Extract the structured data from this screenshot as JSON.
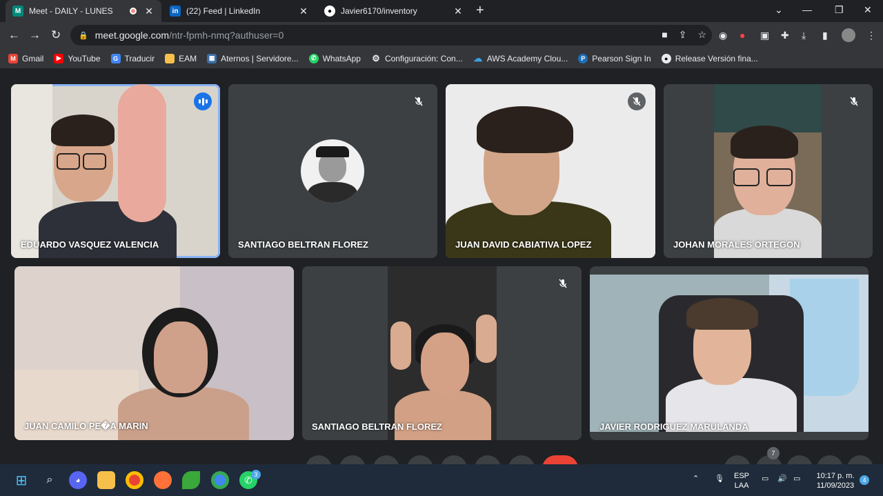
{
  "browser": {
    "tabs": [
      {
        "title": "Meet - DAILY - LUNES",
        "icon": "meet-icon"
      },
      {
        "title": "(22) Feed | LinkedIn",
        "icon": "linkedin-icon"
      },
      {
        "title": "Javier6170/inventory",
        "icon": "github-icon"
      }
    ],
    "url_host": "meet.google.com",
    "url_path": "/ntr-fpmh-nmq?authuser=0",
    "bookmarks": [
      {
        "label": "Gmail",
        "color": "#ea4335"
      },
      {
        "label": "YouTube",
        "color": "#ff0000"
      },
      {
        "label": "Traducir",
        "color": "#4285f4"
      },
      {
        "label": "EAM",
        "color": "#f6c04a"
      },
      {
        "label": "Aternos | Servidore...",
        "color": "#3b6ea5"
      },
      {
        "label": "WhatsApp",
        "color": "#25d366"
      },
      {
        "label": "Configuración: Con...",
        "color": "#9aa0a6"
      },
      {
        "label": "AWS Academy Clou...",
        "color": "#3aa0e6"
      },
      {
        "label": "Pearson Sign In",
        "color": "#1d6fb8"
      },
      {
        "label": "Release Versión fina...",
        "color": "#e8eaed"
      }
    ]
  },
  "meeting": {
    "participants": [
      {
        "name": "EDUARDO VASQUEZ VALENCIA",
        "speaking": true,
        "muted": false
      },
      {
        "name": "SANTIAGO BELTRAN FLOREZ",
        "speaking": false,
        "muted": true
      },
      {
        "name": "JUAN DAVID CABIATIVA LOPEZ",
        "speaking": false,
        "muted": true
      },
      {
        "name": "JOHAN MORALES ORTEGON",
        "speaking": false,
        "muted": true
      },
      {
        "name": "JUAN CAMILO PE�A MARIN",
        "speaking": false,
        "muted": false
      },
      {
        "name": "SANTIAGO BELTRAN FLOREZ",
        "speaking": false,
        "muted": true
      },
      {
        "name": "JAVIER RODRIGUEZ MARULANDA",
        "speaking": false,
        "muted": false
      }
    ],
    "participant_count": "7"
  },
  "taskbar": {
    "lang_top": "ESP",
    "lang_bottom": "LAA",
    "time": "10:17 p. m.",
    "date": "11/09/2023",
    "notifications": "4",
    "whatsapp_badge": "3"
  }
}
